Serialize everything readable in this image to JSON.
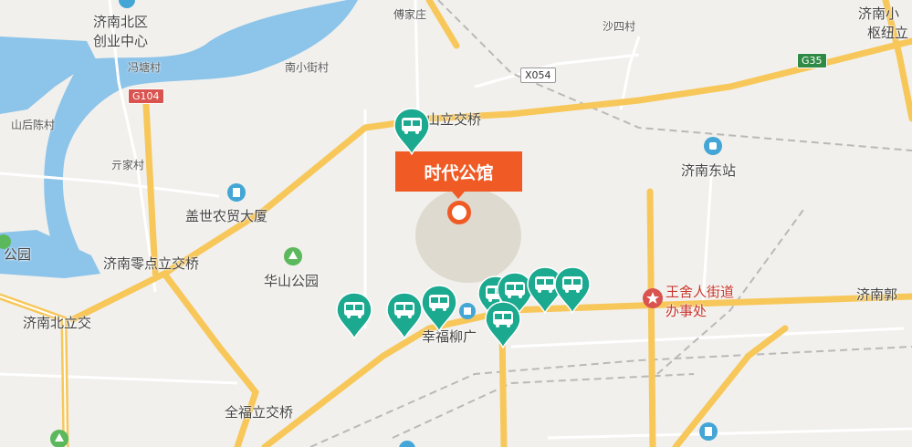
{
  "map": {
    "callout_title": "时代公馆",
    "places": {
      "jinan_north_center_line1": "济南北区",
      "jinan_north_center_line2": "创业中心",
      "fengtang": "冯塘村",
      "nanxiaojie": "南小街村",
      "fujiazhuang": "傅家庄",
      "shasi": "沙四村",
      "jinan_hub_line1": "济南小",
      "jinan_hub_line2": "枢纽立",
      "shanhouchen": "山后陈村",
      "qianjia": "亓家村",
      "huashan_bridge": "华山立交桥",
      "gaishi": "盖世农贸大厦",
      "jinan_east_station": "济南东站",
      "park_left": "公园",
      "lingdian_bridge": "济南零点立交桥",
      "huashan_park": "华山公园",
      "wangsheren_line1": "王舍人街道",
      "wangsheren_line2": "办事处",
      "jinan_guo": "济南郭",
      "jinan_north_bridge": "济南北立交",
      "xingfuliu": "幸福柳广",
      "quanfu_bridge": "全福立交桥"
    },
    "shields": {
      "g104": "G104",
      "x054": "X054",
      "g35": "G35"
    },
    "bus_pins": [
      "bus-stop",
      "bus-stop",
      "bus-stop",
      "bus-stop",
      "bus-stop",
      "bus-stop",
      "bus-stop",
      "bus-stop",
      "bus-stop"
    ],
    "colors": {
      "land": "#f1f0ec",
      "water": "#8cc4ea",
      "highway": "#f7c75a",
      "pin": "#1ba98f",
      "callout": "#f05a24"
    }
  }
}
